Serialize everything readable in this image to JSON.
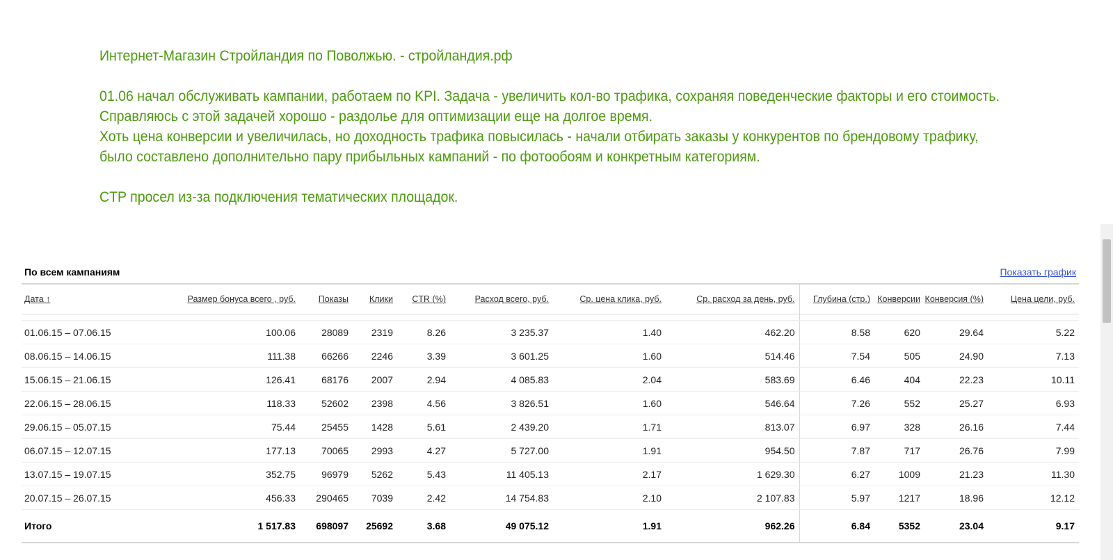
{
  "notes": {
    "line1": "Интернет-Магазин Стройландия по Поволжью. - стройландия.рф",
    "line2": "01.06 начал обслуживать кампании, работаем по KPI. Задача - увеличить кол-во трафика, сохраняя поведенческие факторы и его стоимость.",
    "line3": "Справляюсь с этой задачей хорошо - раздолье для оптимизации еще на долгое время.",
    "line4": "Хоть цена конверсии и увеличилась, но доходность трафика повысилась - начали отбирать заказы у конкурентов по брендовому трафику,",
    "line5": "было составлено дополнительно пару прибыльных кампаний - по фотообоям и конкретным категориям.",
    "line6": "CTP просел из-за подключения тематических площадок."
  },
  "report": {
    "title": "По всем кампаниям",
    "chart_link": "Показать график",
    "columns": [
      "Дата ↑",
      "Размер бонуса всего , руб.",
      "Показы",
      "Клики",
      "CTR (%)",
      "Расход всего, руб.",
      "Ср. цена клика, руб.",
      "Ср. расход за день, руб.",
      "Глубина (стр.)",
      "Конверсии",
      "Конверсия (%)",
      "Цена цели, руб."
    ],
    "rows": [
      [
        "01.06.15 – 07.06.15",
        "100.06",
        "28089",
        "2319",
        "8.26",
        "3 235.37",
        "1.40",
        "462.20",
        "8.58",
        "620",
        "29.64",
        "5.22"
      ],
      [
        "08.06.15 – 14.06.15",
        "111.38",
        "66266",
        "2246",
        "3.39",
        "3 601.25",
        "1.60",
        "514.46",
        "7.54",
        "505",
        "24.90",
        "7.13"
      ],
      [
        "15.06.15 – 21.06.15",
        "126.41",
        "68176",
        "2007",
        "2.94",
        "4 085.83",
        "2.04",
        "583.69",
        "6.46",
        "404",
        "22.23",
        "10.11"
      ],
      [
        "22.06.15 – 28.06.15",
        "118.33",
        "52602",
        "2398",
        "4.56",
        "3 826.51",
        "1.60",
        "546.64",
        "7.26",
        "552",
        "25.27",
        "6.93"
      ],
      [
        "29.06.15 – 05.07.15",
        "75.44",
        "25455",
        "1428",
        "5.61",
        "2 439.20",
        "1.71",
        "813.07",
        "6.97",
        "328",
        "26.16",
        "7.44"
      ],
      [
        "06.07.15 – 12.07.15",
        "177.13",
        "70065",
        "2993",
        "4.27",
        "5 727.00",
        "1.91",
        "954.50",
        "7.87",
        "717",
        "26.76",
        "7.99"
      ],
      [
        "13.07.15 – 19.07.15",
        "352.75",
        "96979",
        "5262",
        "5.43",
        "11 405.13",
        "2.17",
        "1 629.30",
        "6.27",
        "1009",
        "21.23",
        "11.30"
      ],
      [
        "20.07.15 – 26.07.15",
        "456.33",
        "290465",
        "7039",
        "2.42",
        "14 754.83",
        "2.10",
        "2 107.83",
        "5.97",
        "1217",
        "18.96",
        "12.12"
      ]
    ],
    "total": [
      "Итого",
      "1 517.83",
      "698097",
      "25692",
      "3.68",
      "49 075.12",
      "1.91",
      "962.26",
      "6.84",
      "5352",
      "23.04",
      "9.17"
    ]
  }
}
